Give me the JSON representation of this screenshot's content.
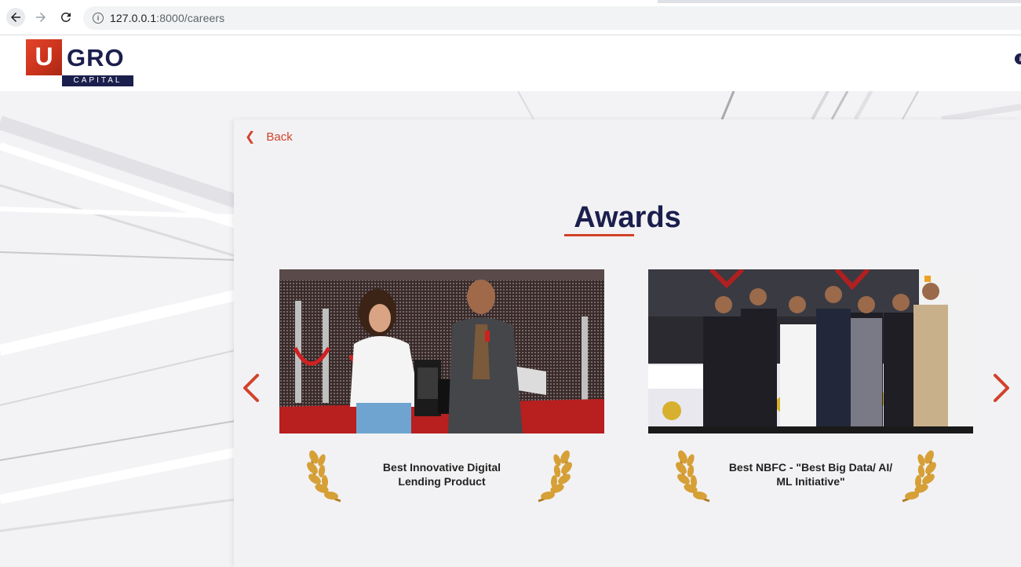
{
  "browser": {
    "url_host": "127.0.0.1",
    "url_path": ":8000/careers"
  },
  "logo": {
    "u": "U",
    "gro": "GRO",
    "capital": "CAPITAL"
  },
  "page": {
    "back_label": "Back",
    "title": "Awards"
  },
  "awards": [
    {
      "caption_line1": "Best Innovative Digital",
      "caption_line2": "Lending Product"
    },
    {
      "caption_line1": "Best NBFC - \"Best Big Data/ AI/",
      "caption_line2": "ML Initiative\""
    }
  ],
  "colors": {
    "brand_navy": "#1b1f4d",
    "brand_red": "#d1432a",
    "laurel_gold": "#d6a037"
  },
  "icons": [
    "back-arrow-icon",
    "forward-arrow-icon",
    "reload-icon",
    "info-icon",
    "chevron-left-icon",
    "laurel-icon",
    "carousel-prev-icon",
    "carousel-next-icon"
  ]
}
